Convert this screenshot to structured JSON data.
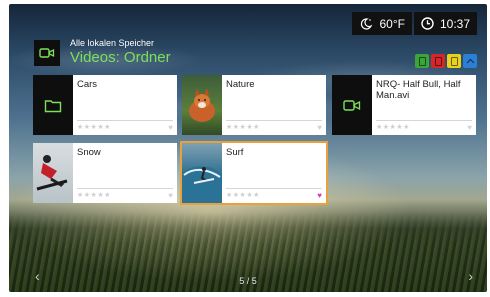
{
  "status": {
    "weather_temp": "60°F",
    "clock_time": "10:37"
  },
  "header": {
    "breadcrumb": "Alle lokalen Speicher",
    "title": "Videos: Ordner"
  },
  "color_buttons": [
    {
      "name": "green",
      "color": "#3aa63a"
    },
    {
      "name": "red",
      "color": "#d7262b"
    },
    {
      "name": "yellow",
      "color": "#e8d21e"
    },
    {
      "name": "blue",
      "color": "#2c7fd6"
    }
  ],
  "tiles": [
    {
      "label": "Cars",
      "kind": "folder",
      "icon": "folder-icon",
      "favorite": false
    },
    {
      "label": "Nature",
      "kind": "photo-fox",
      "favorite": false
    },
    {
      "label": "NRQ- Half Bull, Half Man.avi",
      "kind": "video",
      "icon": "video-camera-icon",
      "favorite": false
    },
    {
      "label": "Snow",
      "kind": "photo-snowboard",
      "favorite": false
    },
    {
      "label": "Surf",
      "kind": "photo-surf",
      "favorite": true,
      "selected": true
    }
  ],
  "pagination": {
    "text": "5 / 5"
  },
  "nav": {
    "prev": "‹",
    "next": "›"
  }
}
